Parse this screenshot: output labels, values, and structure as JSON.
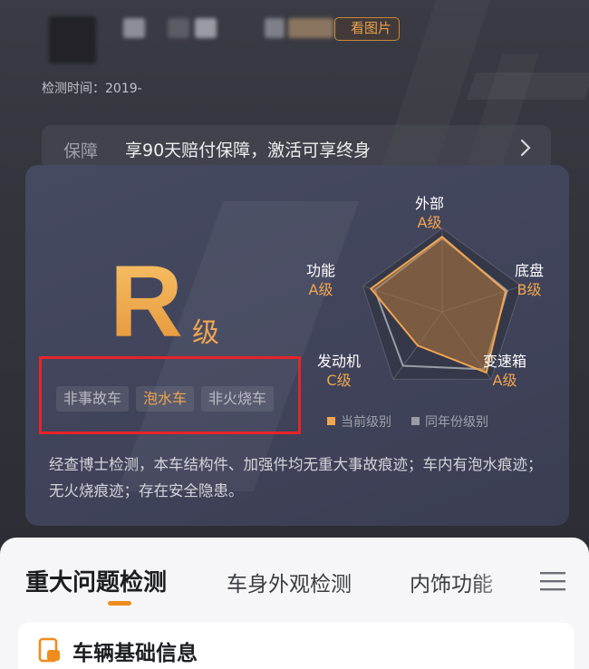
{
  "header": {
    "view_image_label": "看图片",
    "time_label": "检测时间：2019-"
  },
  "guarantee": {
    "label": "保障",
    "text": "享90天赔付保障，激活可享终身"
  },
  "report": {
    "grade_letter": "R",
    "grade_suffix": "级",
    "tags": [
      {
        "label": "非事故车",
        "highlight": false
      },
      {
        "label": "泡水车",
        "highlight": true
      },
      {
        "label": "非火烧车",
        "highlight": false
      }
    ],
    "radar": {
      "axes": [
        {
          "name": "外部",
          "grade": "A级"
        },
        {
          "name": "底盘",
          "grade": "B级"
        },
        {
          "name": "变速箱",
          "grade": "A级"
        },
        {
          "name": "发动机",
          "grade": "C级"
        },
        {
          "name": "功能",
          "grade": "A级"
        }
      ],
      "current_level": [
        0.9,
        0.8,
        0.9,
        0.5,
        0.9
      ],
      "peer_level": [
        0.88,
        0.82,
        0.85,
        0.8,
        0.85
      ]
    },
    "legend": {
      "current": "当前级别",
      "peer": "同年份级别"
    },
    "summary": "经查博士检测，本车结构件、加强件均无重大事故痕迹；车内有泡水痕迹；无火烧痕迹；存在安全隐患。"
  },
  "tabs": [
    {
      "label": "重大问题检测",
      "active": true
    },
    {
      "label": "车身外观检测",
      "active": false
    },
    {
      "label": "内饰功能",
      "active": false
    }
  ],
  "info_card": {
    "title": "车辆基础信息"
  },
  "colors": {
    "accent": "#f08c1e",
    "grade": "#f0a550",
    "highlight_box": "#e8232a"
  }
}
